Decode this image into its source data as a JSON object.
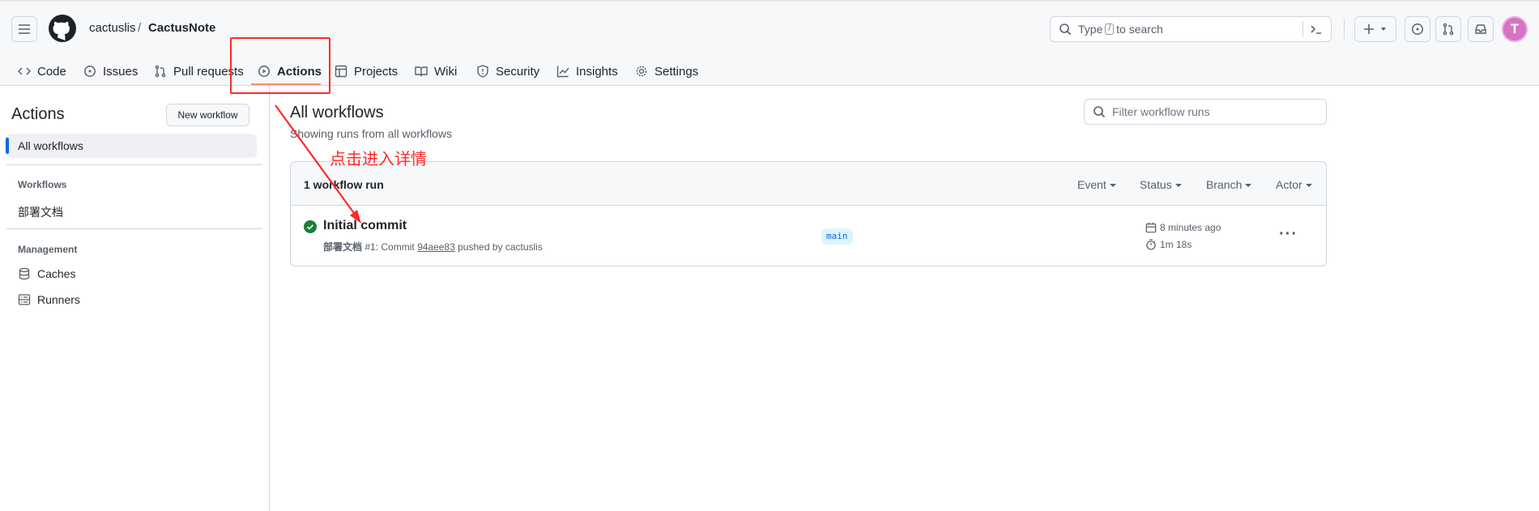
{
  "repo": {
    "owner": "cactuslis",
    "separator": "/",
    "name": "CactusNote"
  },
  "search": {
    "prefix": "Type",
    "key": "/",
    "suffix": "to search"
  },
  "avatar": {
    "initial": "T",
    "color": "#d674c4"
  },
  "tabs": [
    {
      "label": "Code",
      "icon": "code-icon"
    },
    {
      "label": "Issues",
      "icon": "issue-icon"
    },
    {
      "label": "Pull requests",
      "icon": "pull-request-icon"
    },
    {
      "label": "Actions",
      "icon": "play-icon",
      "active": true
    },
    {
      "label": "Projects",
      "icon": "table-icon"
    },
    {
      "label": "Wiki",
      "icon": "book-icon"
    },
    {
      "label": "Security",
      "icon": "shield-icon"
    },
    {
      "label": "Insights",
      "icon": "graph-icon"
    },
    {
      "label": "Settings",
      "icon": "gear-icon"
    }
  ],
  "sidebar": {
    "title": "Actions",
    "new_workflow": "New workflow",
    "all_workflows": "All workflows",
    "workflows_heading": "Workflows",
    "workflow_item": "部署文档",
    "management_heading": "Management",
    "caches": "Caches",
    "runners": "Runners"
  },
  "main": {
    "title": "All workflows",
    "subtitle": "Showing runs from all workflows",
    "filter_placeholder": "Filter workflow runs",
    "run_count": "1 workflow run",
    "filters": [
      "Event",
      "Status",
      "Branch",
      "Actor"
    ],
    "run": {
      "title": "Initial commit",
      "workflow": "部署文档",
      "meta_mid": "#1: Commit",
      "sha": "94aee83",
      "meta_end": "pushed by cactuslis",
      "branch": "main",
      "time_ago": "8 minutes ago",
      "duration": "1m 18s",
      "status_color": "#1a7f37"
    }
  },
  "annotation": {
    "text": "点击进入详情",
    "color": "#ff2a2a"
  }
}
